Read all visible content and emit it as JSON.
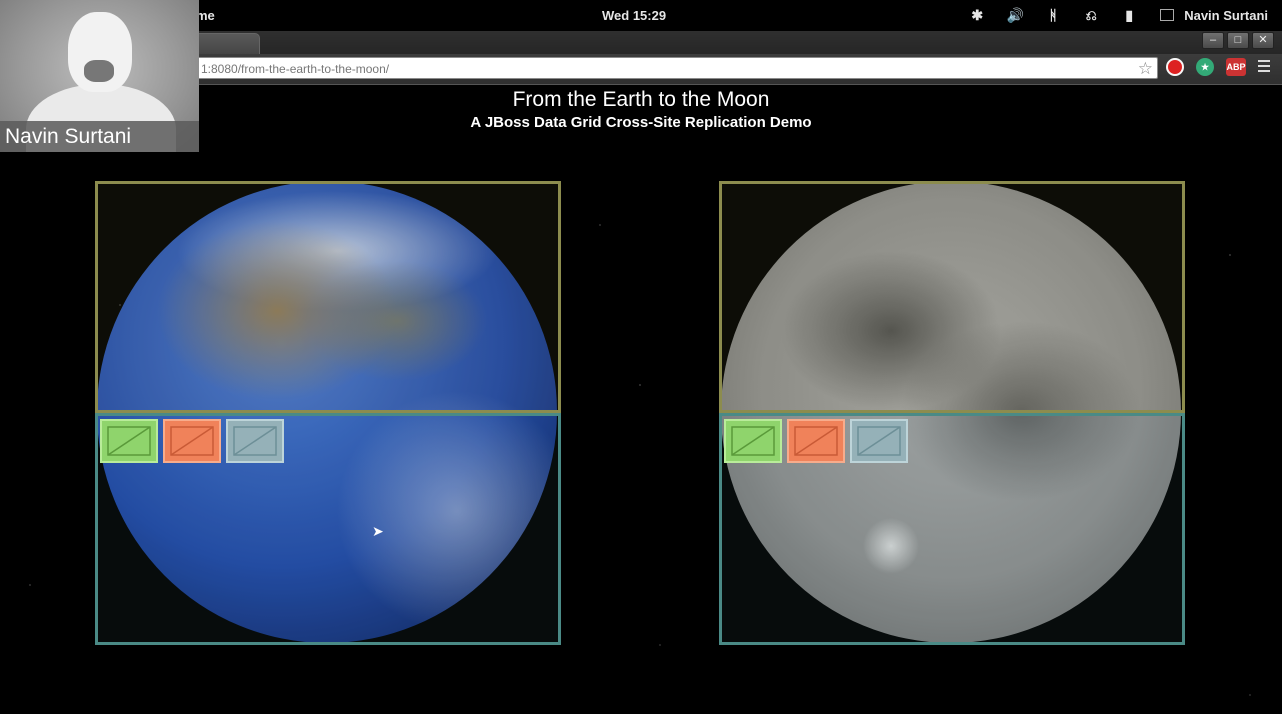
{
  "desktop": {
    "app_menu": "ome",
    "clock": "Wed 15:29",
    "user": "Navin Surtani",
    "tray_icons": [
      "accessibility-icon",
      "volume-icon",
      "bluetooth-icon",
      "network-icon",
      "battery-icon",
      "user-icon"
    ]
  },
  "browser": {
    "url": "1:8080/from-the-earth-to-the-moon/",
    "window_buttons": [
      "minimize",
      "maximize",
      "close"
    ],
    "extension_icons": [
      "extension-red-icon",
      "extension-green-icon",
      "adblock-icon"
    ],
    "adblock_label": "ABP"
  },
  "webcam": {
    "name": "Navin Surtani"
  },
  "page": {
    "title": "From the Earth to the Moon",
    "subtitle": "A JBoss Data Grid Cross-Site Replication Demo",
    "sites": [
      {
        "name": "earth",
        "nodes": [
          "green",
          "orange",
          "blue"
        ]
      },
      {
        "name": "moon",
        "nodes": [
          "green",
          "orange",
          "blue"
        ]
      }
    ]
  },
  "colors": {
    "node_green": "#8fd46c",
    "node_orange": "#f0825a",
    "node_blue": "#95b1b8",
    "top_border": "#8c8c4e",
    "bottom_border": "#4a8a86"
  }
}
